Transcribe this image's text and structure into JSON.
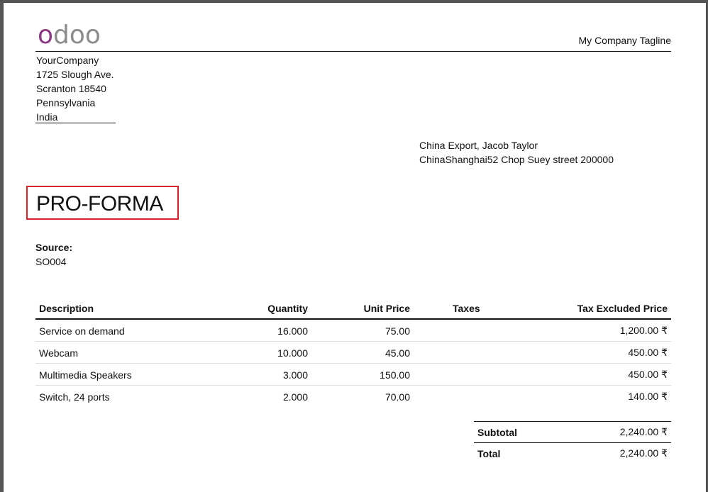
{
  "logo": {
    "first": "o",
    "rest": "doo"
  },
  "header": {
    "tagline": "My Company Tagline"
  },
  "company": {
    "lines": [
      "YourCompany",
      "1725 Slough Ave.",
      "Scranton 18540",
      "Pennsylvania",
      "India"
    ]
  },
  "partner": {
    "lines": [
      "China Export, Jacob Taylor",
      "ChinaShanghai52 Chop Suey street 200000"
    ]
  },
  "document": {
    "title": "PRO-FORMA",
    "source_label": "Source:",
    "source_value": "SO004"
  },
  "lines": {
    "headers": [
      "Description",
      "Quantity",
      "Unit Price",
      "Taxes",
      "Tax Excluded Price"
    ],
    "rows": [
      [
        "Service on demand",
        "16.000",
        "75.00",
        "",
        "1,200.00 ₹"
      ],
      [
        "Webcam",
        "10.000",
        "45.00",
        "",
        "450.00 ₹"
      ],
      [
        "Multimedia Speakers",
        "3.000",
        "150.00",
        "",
        "450.00 ₹"
      ],
      [
        "Switch, 24 ports",
        "2.000",
        "70.00",
        "",
        "140.00 ₹"
      ]
    ]
  },
  "totals": {
    "subtotal_label": "Subtotal",
    "subtotal_value": "2,240.00 ₹",
    "total_label": "Total",
    "total_value": "2,240.00 ₹"
  },
  "colors": {
    "logo_accent": "#8f3a84",
    "logo_gray": "#8c8c8c",
    "highlight": "#d9232b"
  }
}
